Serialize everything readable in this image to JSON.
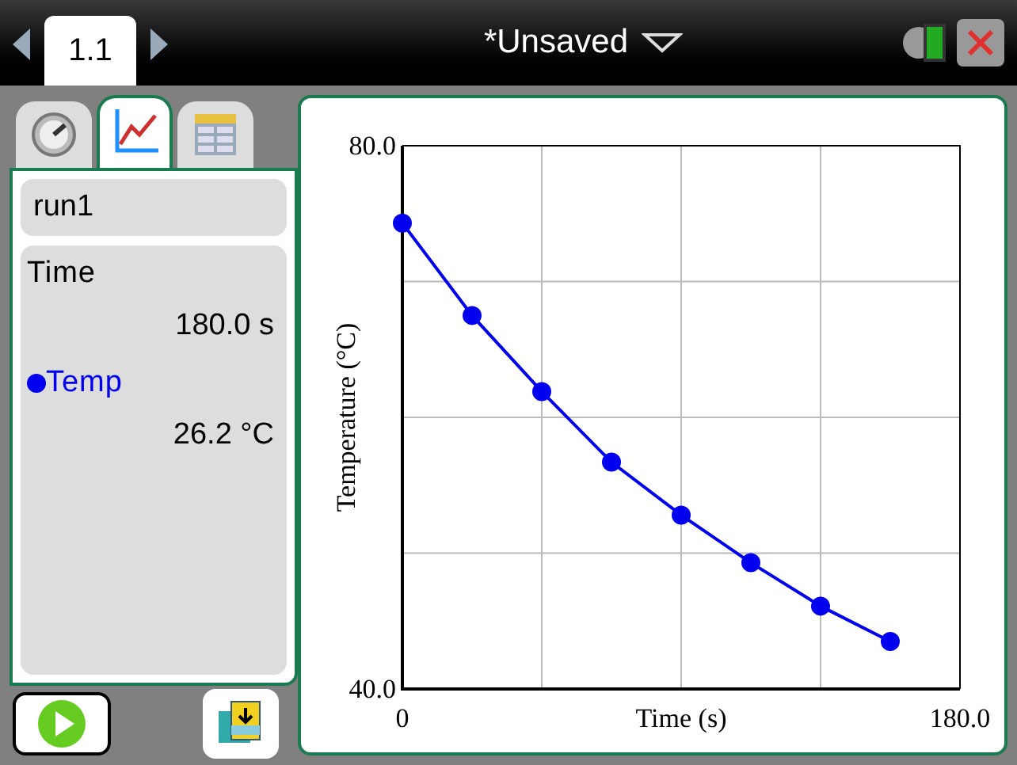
{
  "top_bar": {
    "page_tab": "1.1",
    "title": "*Unsaved"
  },
  "side_tabs": [
    {
      "kind": "meter",
      "selected": false
    },
    {
      "kind": "graph",
      "selected": true
    },
    {
      "kind": "table",
      "selected": false
    }
  ],
  "run": "run1",
  "readings": [
    {
      "name": "Time",
      "value": "180.0 s",
      "color": "#000000"
    },
    {
      "name": "Temp",
      "value": "26.2 °C",
      "color": "#0000ee"
    }
  ],
  "graph": {
    "chart_data": {
      "type": "line",
      "xlabel": "Time (s)",
      "ylabel": "Temperature (°C)",
      "x": [
        0,
        22.5,
        45,
        67.5,
        90,
        112.5,
        135,
        157.5
      ],
      "xlim": [
        0,
        180
      ],
      "ylim": [
        40,
        80
      ],
      "xticks": [
        {
          "value": 0,
          "label": "0"
        },
        {
          "value": 180,
          "label": "180.0"
        }
      ],
      "yticks": [
        {
          "value": 40,
          "label": "40.0"
        },
        {
          "value": 80,
          "label": "80.0"
        }
      ],
      "series": [
        {
          "color": "#0000ee",
          "marker": "circle",
          "values": [
            74.3,
            67.5,
            61.9,
            56.7,
            52.8,
            49.3,
            46.1,
            43.5
          ]
        }
      ]
    }
  }
}
